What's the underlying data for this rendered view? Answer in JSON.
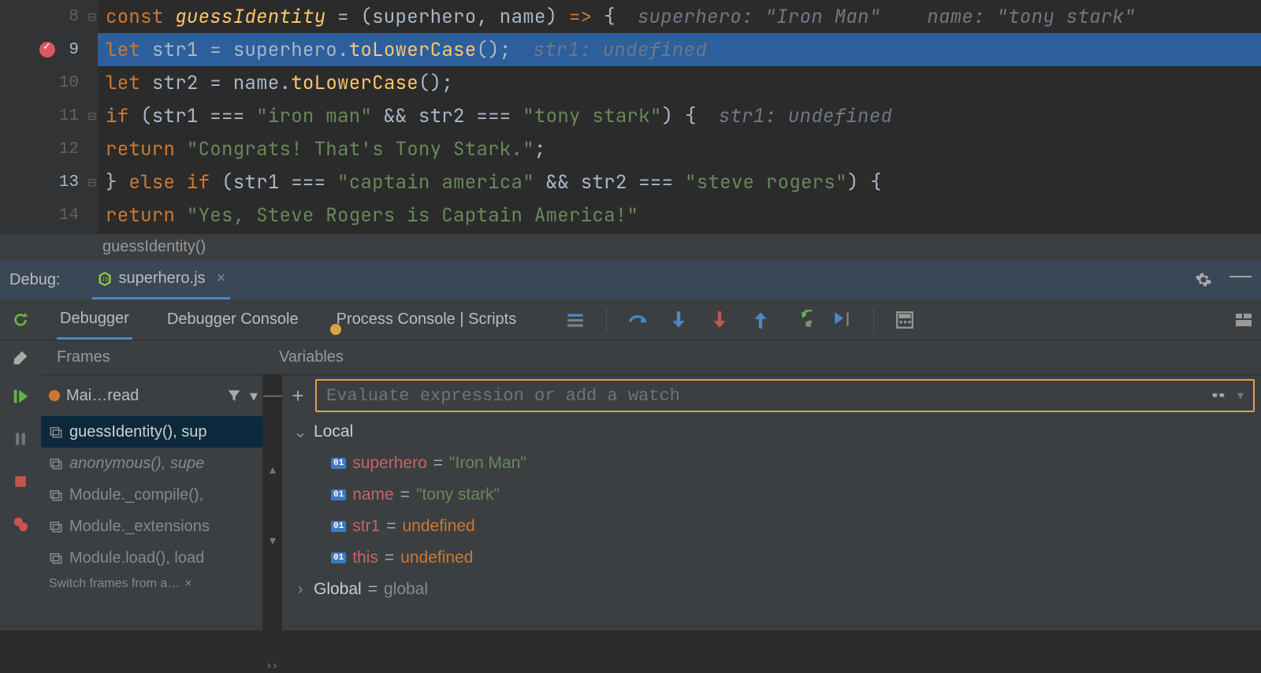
{
  "editor": {
    "lines": [
      {
        "n": 8,
        "hl": false,
        "bp": false,
        "fold": "⊟",
        "html": "<span class='kw'>const </span><span class='def'>guessIdentity</span><span class='id'> = (superhero, name) </span><span class='kw'>=&gt;</span><span class='id'> {</span><span class='inlay'>superhero: \"Iron Man\"    name: \"tony stark\"</span>"
      },
      {
        "n": 9,
        "hl": true,
        "bp": true,
        "fold": "",
        "html": "    <span class='kw'>let </span><span class='id'>str1 = superhero.</span><span class='fn'>toLowerCase</span><span class='id'>();</span><span class='inlay'>str1: undefined</span>"
      },
      {
        "n": 10,
        "hl": false,
        "bp": false,
        "fold": "",
        "html": "    <span class='kw'>let </span><span class='id'>str2 = name.</span><span class='fn'>toLowerCase</span><span class='id'>();</span>"
      },
      {
        "n": 11,
        "hl": false,
        "bp": false,
        "fold": "⊟",
        "html": "    <span class='kw'>if </span><span class='id'>(str1 === </span><span class='str'>\"iron man\"</span><span class='id'> &amp;&amp; str2 === </span><span class='str'>\"tony stark\"</span><span class='id'>) {</span><span class='inlay'>str1: undefined</span>"
      },
      {
        "n": 12,
        "hl": false,
        "bp": false,
        "fold": "",
        "html": "        <span class='kw'>return </span><span class='str'>\"Congrats! That's Tony Stark.\"</span><span class='id'>;</span>"
      },
      {
        "n": 13,
        "hl": false,
        "bp": false,
        "fold": "⊟",
        "html": "    <span class='id'>} </span><span class='kw'>else if </span><span class='id'>(str1 === </span><span class='str'>\"captain america\"</span><span class='id'> &amp;&amp; str2 === </span><span class='str'>\"steve rogers\"</span><span class='id'>) {</span>"
      },
      {
        "n": 14,
        "hl": false,
        "bp": false,
        "fold": "",
        "html": "        <span class='kw'>return </span><span class='str'>\"Yes, Steve Rogers is Captain America!\"</span>"
      }
    ],
    "breadcrumb": "guessIdentity()"
  },
  "debug_header": {
    "label": "Debug:",
    "file": "superhero.js"
  },
  "debug_tabs": {
    "debugger": "Debugger",
    "console": "Debugger Console",
    "process": "Process Console | Scripts"
  },
  "panels": {
    "frames_label": "Frames",
    "vars_label": "Variables"
  },
  "frames": {
    "thread": "Mai…read",
    "stack": [
      {
        "label": "guessIdentity(), sup",
        "sel": true,
        "italic": false
      },
      {
        "label": "anonymous(), supe",
        "sel": false,
        "italic": true
      },
      {
        "label": "Module._compile(),",
        "sel": false,
        "italic": false
      },
      {
        "label": "Module._extensions",
        "sel": false,
        "italic": false
      },
      {
        "label": "Module.load(), load",
        "sel": false,
        "italic": false
      }
    ],
    "hint": "Switch frames from a…"
  },
  "watch": {
    "placeholder": "Evaluate expression or add a watch"
  },
  "variables": {
    "local_label": "Local",
    "items": [
      {
        "name": "superhero",
        "value": "\"Iron Man\"",
        "kind": "str"
      },
      {
        "name": "name",
        "value": "\"tony stark\"",
        "kind": "str"
      },
      {
        "name": "str1",
        "value": "undefined",
        "kind": "und"
      },
      {
        "name": "this",
        "value": "undefined",
        "kind": "und"
      }
    ],
    "global_label": "Global",
    "global_value": "global"
  }
}
